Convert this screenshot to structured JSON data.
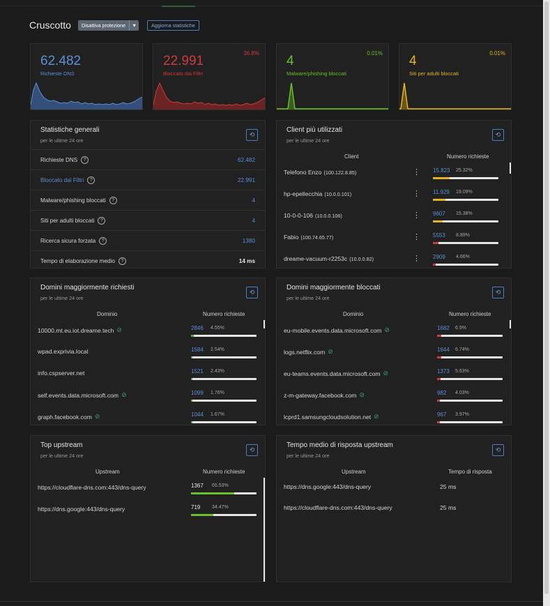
{
  "header": {
    "title": "Cruscotto",
    "protection_button": "Disattiva protezione",
    "refresh_stats_button": "Aggiorna statistiche"
  },
  "colors": {
    "blue": "#5b8fd9",
    "red": "#d23a3a",
    "green": "#6bbf2a",
    "yellow": "#e4b425"
  },
  "stat_cards": [
    {
      "value": "62.482",
      "label": "Richieste DNS",
      "percent": "",
      "color": "#5b8fd9"
    },
    {
      "value": "22.991",
      "label": "Bloccato dai Filtri",
      "percent": "36.8%",
      "color": "#d23a3a"
    },
    {
      "value": "4",
      "label": "Malware/phishing bloccati",
      "percent": "0.01%",
      "color": "#6bbf2a"
    },
    {
      "value": "4",
      "label": "Siti per adulti bloccati",
      "percent": "0.01%",
      "color": "#e4b425"
    }
  ],
  "general": {
    "title": "Statistiche generali",
    "subtitle": "per le ultime 24 ore",
    "rows": [
      {
        "label": "Richieste DNS",
        "value": "62.482"
      },
      {
        "label": "Bloccato dai Filtri",
        "value": "22.991"
      },
      {
        "label": "Malware/phishing bloccati",
        "value": "4"
      },
      {
        "label": "Siti per adulti bloccati",
        "value": "4"
      },
      {
        "label": "Ricerca sicura forzata",
        "value": "1380"
      },
      {
        "label": "Tempo di elaborazione medio",
        "value": "14 ms"
      }
    ]
  },
  "clients": {
    "title": "Client più utilizzati",
    "subtitle": "per le ultime 24 ore",
    "col1": "Client",
    "col2": "Numero richieste",
    "rows": [
      {
        "name": "Telefono Enzo",
        "ip": "(100.122.8.85)",
        "count": "15.823",
        "pct": "25.32%",
        "fraction": 0.2532,
        "color": "#e4b425"
      },
      {
        "name": "hp-epellecchia",
        "ip": "(10.0.0.101)",
        "count": "11.929",
        "pct": "19.09%",
        "fraction": 0.1909,
        "color": "#e4b425"
      },
      {
        "name": "10-0-0-106",
        "ip": "(10.0.0.106)",
        "count": "9607",
        "pct": "15.38%",
        "fraction": 0.1538,
        "color": "#e4b425"
      },
      {
        "name": "Fabio",
        "ip": "(100.74.65.77)",
        "count": "5553",
        "pct": "8.89%",
        "fraction": 0.0889,
        "color": "#d23a3a"
      },
      {
        "name": "dreame-vacuum-r2253c",
        "ip": "(10.0.0.82)",
        "count": "2909",
        "pct": "4.66%",
        "fraction": 0.0466,
        "color": "#d23a3a"
      }
    ]
  },
  "top_domains": {
    "title": "Domini maggiormente richiesti",
    "subtitle": "per le ultime 24 ore",
    "col1": "Dominio",
    "col2": "Numero richieste",
    "rows": [
      {
        "name": "10000.mt.eu.iot.dreame.tech",
        "eye": true,
        "count": "2846",
        "pct": "4.55%",
        "fraction": 0.0455
      },
      {
        "name": "wpad.exprivia.local",
        "eye": false,
        "count": "1584",
        "pct": "2.54%",
        "fraction": 0.0254
      },
      {
        "name": "info.cspserver.net",
        "eye": false,
        "count": "1521",
        "pct": "2.43%",
        "fraction": 0.0243
      },
      {
        "name": "self.events.data.microsoft.com",
        "eye": true,
        "count": "1099",
        "pct": "1.76%",
        "fraction": 0.0176
      },
      {
        "name": "graph.facebook.com",
        "eye": true,
        "count": "1044",
        "pct": "1.67%",
        "fraction": 0.0167
      }
    ]
  },
  "blocked_domains": {
    "title": "Domini maggiormente bloccati",
    "subtitle": "per le ultime 24 ore",
    "col1": "Dominio",
    "col2": "Numero richieste",
    "rows": [
      {
        "name": "eu-mobile.events.data.microsoft.com",
        "count": "1682",
        "pct": "6.9%",
        "fraction": 0.069
      },
      {
        "name": "logs.netflix.com",
        "count": "1644",
        "pct": "6.74%",
        "fraction": 0.0674
      },
      {
        "name": "eu-teams.events.data.microsoft.com",
        "count": "1373",
        "pct": "5.63%",
        "fraction": 0.0563
      },
      {
        "name": "z-m-gateway.facebook.com",
        "count": "982",
        "pct": "4.03%",
        "fraction": 0.0403
      },
      {
        "name": "lcprd1.samsungcloudsolution.net",
        "count": "967",
        "pct": "3.97%",
        "fraction": 0.0397
      }
    ]
  },
  "top_upstream": {
    "title": "Top upstream",
    "subtitle": "per le ultime 24 ore",
    "col1": "Upstream",
    "col2": "Numero richieste",
    "rows": [
      {
        "name": "https://cloudflare-dns.com:443/dns-query",
        "count": "1367",
        "pct": "65.53%",
        "fraction": 0.6553
      },
      {
        "name": "https://dns.google:443/dns-query",
        "count": "719",
        "pct": "34.47%",
        "fraction": 0.3447
      }
    ]
  },
  "upstream_time": {
    "title": "Tempo medio di risposta upstream",
    "subtitle": "per le ultime 24 ore",
    "col1": "Upstream",
    "col2": "Tempo di risposta",
    "rows": [
      {
        "name": "https://dns.google:443/dns-query",
        "time": "25 ms"
      },
      {
        "name": "https://cloudflare-dns.com:443/dns-query",
        "time": "25 ms"
      }
    ]
  }
}
